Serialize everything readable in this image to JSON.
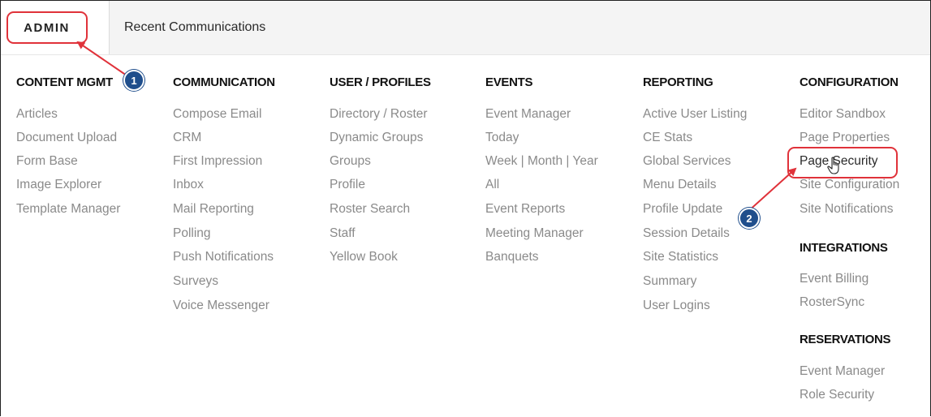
{
  "tabs": [
    {
      "label": "ADMIN"
    },
    {
      "label": "Recent Communications"
    }
  ],
  "columns": [
    {
      "heading": "CONTENT MGMT",
      "items": [
        "Articles",
        "Document Upload",
        "Form Base",
        "Image Explorer",
        "Template Manager"
      ]
    },
    {
      "heading": "COMMUNICATION",
      "items": [
        "Compose Email",
        "CRM",
        "First Impression",
        "Inbox",
        "Mail Reporting",
        "Polling",
        "Push Notifications",
        "Surveys",
        "Voice Messenger"
      ]
    },
    {
      "heading": "USER / PROFILES",
      "items": [
        "Directory / Roster",
        "Dynamic Groups",
        "Groups",
        "Profile",
        "Roster Search",
        "Staff",
        "Yellow Book"
      ]
    },
    {
      "heading": "EVENTS",
      "items": [
        "Event Manager",
        "Today",
        "Week | Month | Year",
        "All",
        "Event Reports",
        "Meeting Manager",
        "Banquets"
      ]
    },
    {
      "heading": "REPORTING",
      "items": [
        "Active User Listing",
        "CE Stats",
        "Global Services",
        "Menu Details",
        "Profile Update",
        "Session Details",
        "Site Statistics",
        "Summary",
        "User Logins"
      ]
    },
    {
      "heading": "CONFIGURATION",
      "items": [
        "Editor Sandbox",
        "Page Properties",
        "Page Security",
        "Site Configuration",
        "Site Notifications"
      ]
    }
  ],
  "integrations": {
    "heading": "INTEGRATIONS",
    "items": [
      "Event Billing",
      "RosterSync"
    ]
  },
  "reservations": {
    "heading": "RESERVATIONS",
    "items": [
      "Event Manager",
      "Role Security"
    ]
  },
  "callouts": [
    {
      "number": "1"
    },
    {
      "number": "2"
    }
  ],
  "colors": {
    "callout": "#e0323a",
    "badge": "#1f4e8c",
    "item_text": "#8a8a8a",
    "heading_text": "#111111"
  }
}
